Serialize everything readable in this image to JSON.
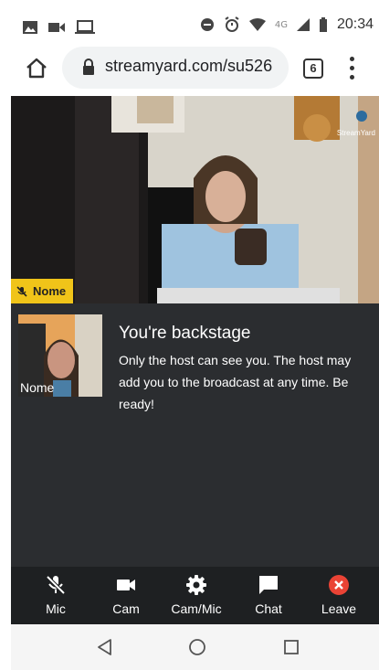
{
  "statusbar": {
    "network": "4G",
    "time": "20:34",
    "icons": [
      "image-icon",
      "video-cast-icon",
      "laptop-icon",
      "do-not-disturb-icon",
      "alarm-icon",
      "wifi-icon",
      "signal-icon",
      "battery-icon"
    ]
  },
  "browser": {
    "url": "streamyard.com/su526",
    "tab_count": "6",
    "icons": [
      "home-icon",
      "lock-icon",
      "more-vert-icon"
    ]
  },
  "video": {
    "name_tag": "Nome",
    "watermark": "StreamYard"
  },
  "backstage": {
    "self_name": "Nome",
    "title": "You're backstage",
    "message": "Only the host can see you. The host may add you to the broadcast at any time. Be ready!"
  },
  "controls": {
    "mic_label": "Mic",
    "cam_label": "Cam",
    "cammic_label": "Cam/Mic",
    "chat_label": "Chat",
    "leave_label": "Leave"
  },
  "colors": {
    "name_tag_bg": "#f0c419",
    "panel_bg": "#2b2d30",
    "controlbar_bg": "#1e2022",
    "leave_red": "#ea4335"
  },
  "navbar": {
    "icons": [
      "back-icon",
      "home-circle-icon",
      "recents-icon"
    ]
  }
}
